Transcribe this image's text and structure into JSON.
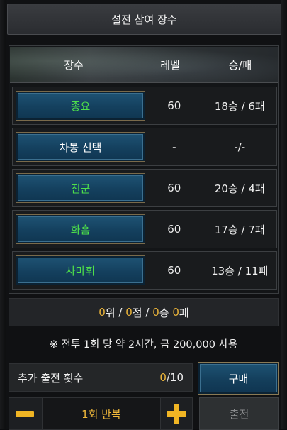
{
  "header": {
    "title": "설전 참여 장수"
  },
  "table": {
    "columns": [
      "장수",
      "레벨",
      "승/패"
    ],
    "rows": [
      {
        "name": "종요",
        "level": "60",
        "record": "18승 / 6패",
        "name_color": "green"
      },
      {
        "name": "차봉 선택",
        "level": "-",
        "record": "-/-",
        "name_color": "white"
      },
      {
        "name": "진군",
        "level": "60",
        "record": "20승 / 4패",
        "name_color": "green"
      },
      {
        "name": "화흠",
        "level": "60",
        "record": "17승 / 7패",
        "name_color": "green"
      },
      {
        "name": "사마휘",
        "level": "60",
        "record": "13승 / 11패",
        "name_color": "green"
      }
    ]
  },
  "summary": {
    "rank_value": "0",
    "rank_unit": "위",
    "sep": " / ",
    "points_value": "0",
    "points_unit": "점",
    "wins_value": "0",
    "wins_unit": "승 ",
    "losses_value": "0",
    "losses_unit": "패"
  },
  "notice": "※ 전투 1회 당 약 2시간, 금 200,000 사용",
  "extra": {
    "label": "추가 출전 횟수",
    "current": "0",
    "max": "/10"
  },
  "buttons": {
    "buy": "구매",
    "sortie": "출전"
  },
  "repeat": {
    "label": "1회 반복"
  },
  "colors": {
    "accent_gold": "#f0b83a",
    "name_green": "#4ee04a",
    "button_blue": "#14405e"
  },
  "icons": {
    "minus": "minus-icon",
    "plus": "plus-icon"
  }
}
